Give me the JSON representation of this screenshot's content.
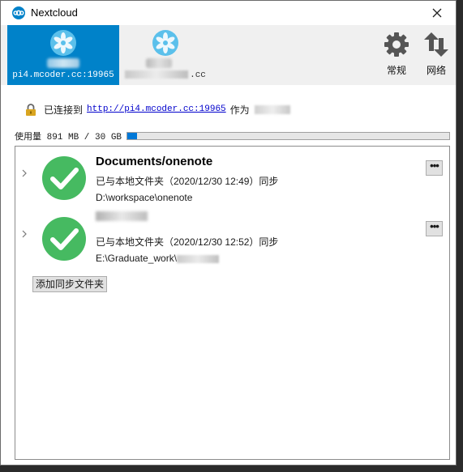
{
  "window": {
    "title": "Nextcloud"
  },
  "accounts": [
    {
      "url": "pi4.mcoder.cc:19965",
      "active": true
    },
    {
      "url_suffix": ".cc",
      "active": false
    }
  ],
  "toolbar": {
    "general_label": "常规",
    "network_label": "网络"
  },
  "status": {
    "prefix": "已连接到",
    "link": "http://pi4.mcoder.cc:19965",
    "as_label": "作为"
  },
  "usage": {
    "text": "使用量 891 MB / 30 GB",
    "fraction": 0.029
  },
  "folders": [
    {
      "title": "Documents/onenote",
      "sync_status": "已与本地文件夹（2020/12/30 12:49）同步",
      "path": "D:\\workspace\\onenote"
    },
    {
      "title": "",
      "sync_status": "已与本地文件夹（2020/12/30 12:52）同步",
      "path": "E:\\Graduate_work\\"
    }
  ],
  "add_folder_label": "添加同步文件夹",
  "colors": {
    "brand": "#0082c9",
    "success": "#46ba61",
    "link": "#0000cc",
    "progress": "#0078d7"
  },
  "icons": [
    "nextcloud-logo-icon",
    "close-icon",
    "gear-icon",
    "network-arrows-icon",
    "lock-icon",
    "check-circle-icon",
    "chevron-right-icon",
    "more-icon"
  ]
}
